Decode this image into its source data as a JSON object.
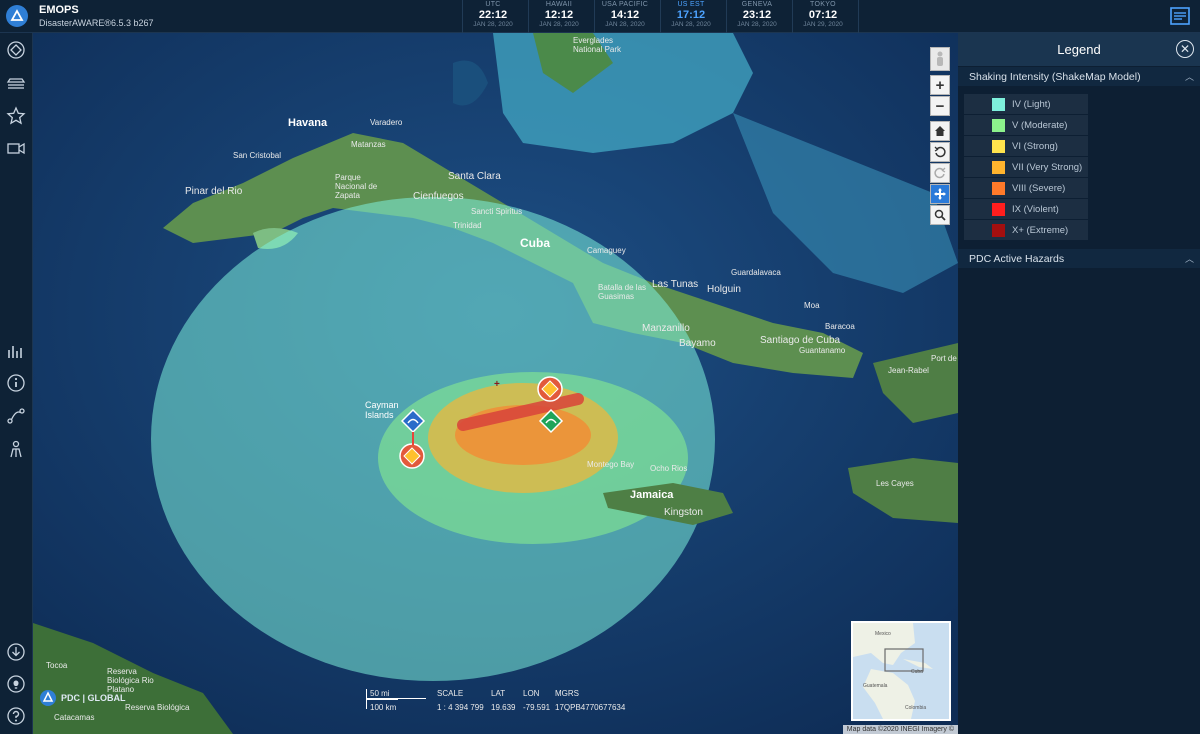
{
  "app": {
    "title": "EMOPS",
    "version": "DisasterAWARE®6.5.3 b267"
  },
  "clocks": [
    {
      "zone": "UTC",
      "time": "22:12",
      "date": "JAN 28, 2020",
      "active": false
    },
    {
      "zone": "HAWAII",
      "time": "12:12",
      "date": "JAN 28, 2020",
      "active": false
    },
    {
      "zone": "USA PACIFIC",
      "time": "14:12",
      "date": "JAN 28, 2020",
      "active": false
    },
    {
      "zone": "US EST",
      "time": "17:12",
      "date": "JAN 28, 2020",
      "active": true
    },
    {
      "zone": "GENEVA",
      "time": "23:12",
      "date": "JAN 28, 2020",
      "active": false
    },
    {
      "zone": "TOKYO",
      "time": "07:12",
      "date": "JAN 29, 2020",
      "active": false
    }
  ],
  "sidebar_icons": [
    "layers-diamond-icon",
    "stack-icon",
    "star-icon",
    "video-icon",
    "chart-icon",
    "info-icon",
    "route-icon",
    "people-icon",
    "download-icon",
    "lightbulb-icon",
    "help-icon"
  ],
  "legend": {
    "title": "Legend",
    "close_symbol": "✕",
    "section1": "Shaking Intensity (ShakeMap Model)",
    "section2": "PDC Active Hazards",
    "intensity": [
      {
        "label": "IV (Light)",
        "color": "#7ef0dc"
      },
      {
        "label": "V (Moderate)",
        "color": "#8cf28c"
      },
      {
        "label": "VI (Strong)",
        "color": "#ffe34d"
      },
      {
        "label": "VII (Very Strong)",
        "color": "#ffb42e"
      },
      {
        "label": "VIII (Severe)",
        "color": "#ff7a2a"
      },
      {
        "label": "IX (Violent)",
        "color": "#ff1e1e"
      },
      {
        "label": "X+ (Extreme)",
        "color": "#a30f0f"
      }
    ]
  },
  "map": {
    "place_labels": [
      {
        "text": "Havana"
      },
      {
        "text": "Varadero"
      },
      {
        "text": "Matanzas"
      },
      {
        "text": "San Cristobal"
      },
      {
        "text": "Pinar del Rio"
      },
      {
        "text": "Cienfuegos"
      },
      {
        "text": "Santa Clara"
      },
      {
        "text": "Sancti Spiritus"
      },
      {
        "text": "Cuba"
      },
      {
        "text": "Camaguey"
      },
      {
        "text": "Las Tunas"
      },
      {
        "text": "Holguin"
      },
      {
        "text": "Bayamo"
      },
      {
        "text": "Manzanillo"
      },
      {
        "text": "Santiago de Cuba"
      },
      {
        "text": "Guantanamo"
      },
      {
        "text": "Moa"
      },
      {
        "text": "Baracoa"
      },
      {
        "text": "Cayman Islands"
      },
      {
        "text": "Montego Bay"
      },
      {
        "text": "Ocho Rios"
      },
      {
        "text": "Jamaica"
      },
      {
        "text": "Kingston"
      },
      {
        "text": "Les Cayes"
      },
      {
        "text": "Jean-Rabel"
      },
      {
        "text": "Port de"
      },
      {
        "text": "Tocoa"
      },
      {
        "text": "Catacamas"
      },
      {
        "text": "Reserva Biológica Rio Platano"
      },
      {
        "text": "Reserva Biológica"
      },
      {
        "text": "Guardalavaca"
      },
      {
        "text": "Batalla de las Guasimas"
      },
      {
        "text": "Trinidad"
      },
      {
        "text": "Parque Nacional de Zapata"
      },
      {
        "text": "Everglades National Park"
      }
    ],
    "scale": {
      "bar_top": "50 mi",
      "bar_bottom": "100 km",
      "scale_label": "SCALE",
      "scale_value": "1 : 4 394 799",
      "lat_label": "LAT",
      "lat_value": "19.639",
      "lon_label": "LON",
      "lon_value": "-79.591",
      "mgrs_label": "MGRS",
      "mgrs_value": "17QPB4770677634"
    },
    "attribution": "Map data ©2020 INEGI Imagery ©",
    "watermark": "PDC | GLOBAL",
    "minimap_labels": [
      "Mexico",
      "Cuba",
      "Guatemala",
      "Colombia"
    ],
    "controls": [
      "pegman-icon",
      "zoom-in-icon",
      "zoom-out-icon",
      "home-icon",
      "rotate-left-icon",
      "rotate-right-icon",
      "pan-icon",
      "zoom-box-icon"
    ]
  }
}
